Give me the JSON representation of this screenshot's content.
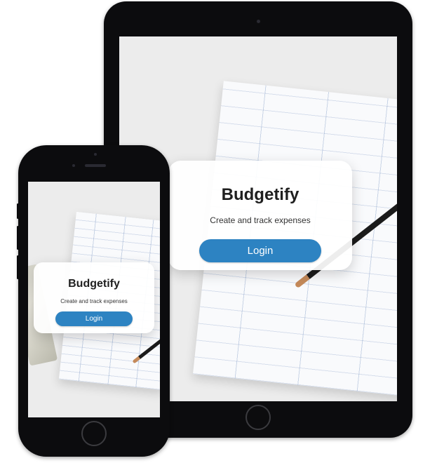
{
  "app": {
    "title": "Budgetify",
    "subtitle": "Create and track expenses",
    "login_label": "Login",
    "accent_color": "#2d83c2"
  },
  "devices": [
    {
      "name": "tablet",
      "icons": [
        "camera-icon",
        "home-button-icon"
      ]
    },
    {
      "name": "phone",
      "icons": [
        "camera-icon",
        "speaker-icon",
        "home-button-icon"
      ]
    }
  ]
}
